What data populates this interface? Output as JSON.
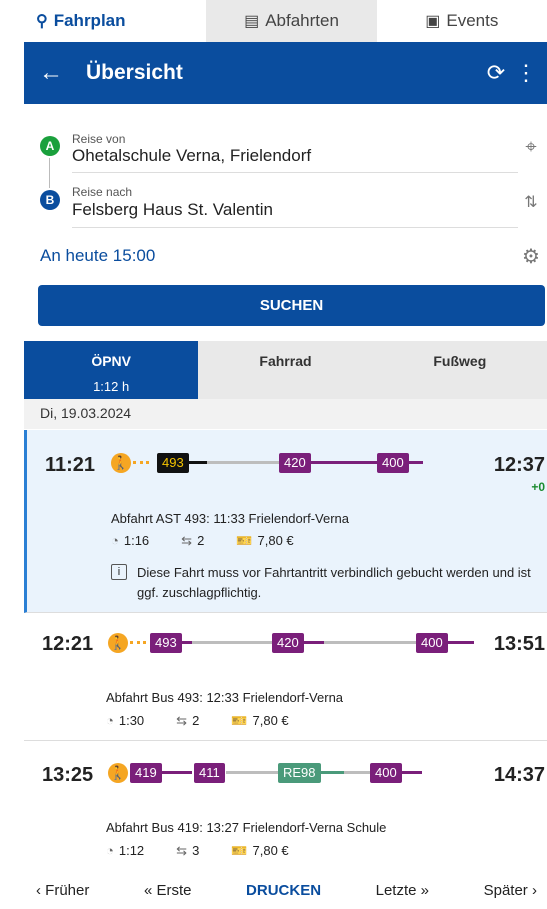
{
  "top_tabs": [
    {
      "label": "Fahrplan",
      "icon": "map-pin-icon"
    },
    {
      "label": "Abfahrten",
      "icon": "departures-icon"
    },
    {
      "label": "Events",
      "icon": "calendar-icon"
    }
  ],
  "header": {
    "title": "Übersicht",
    "back_icon": "arrow-left-icon",
    "refresh_icon": "refresh-icon",
    "menu_icon": "more-vertical-icon"
  },
  "form": {
    "from_label": "Reise von",
    "from_value": "Ohetalschule Verna, Frielendorf",
    "to_label": "Reise nach",
    "to_value": "Felsberg Haus St. Valentin",
    "marker_a": "A",
    "marker_b": "B",
    "time_text": "An heute 15:00",
    "search_label": "SUCHEN"
  },
  "mode_tabs": [
    {
      "label": "ÖPNV",
      "duration": "1:12 h"
    },
    {
      "label": "Fahrrad"
    },
    {
      "label": "Fußweg"
    }
  ],
  "date": "Di, 19.03.2024",
  "connections": [
    {
      "departure": "11:21",
      "arrival": "12:37",
      "delay": "+0",
      "lines": [
        "493",
        "420",
        "400"
      ],
      "info": "Abfahrt AST 493: 11:33 Frielendorf-Verna",
      "duration": "1:16",
      "changes": "2",
      "price": "7,80 €",
      "notice": "Diese Fahrt muss vor Fahrtantritt verbindlich gebucht werden und ist ggf. zuschlagpflichtig."
    },
    {
      "departure": "12:21",
      "arrival": "13:51",
      "lines": [
        "493",
        "420",
        "400"
      ],
      "info": "Abfahrt Bus 493: 12:33 Frielendorf-Verna",
      "duration": "1:30",
      "changes": "2",
      "price": "7,80 €"
    },
    {
      "departure": "13:25",
      "arrival": "14:37",
      "lines": [
        "419",
        "411",
        "RE98",
        "400"
      ],
      "info": "Abfahrt Bus 419: 13:27 Frielendorf-Verna Schule",
      "duration": "1:12",
      "changes": "3",
      "price": "7,80 €"
    }
  ],
  "footer": {
    "earlier": "Früher",
    "first": "Erste",
    "print": "DRUCKEN",
    "last": "Letzte",
    "later": "Später"
  },
  "colors": {
    "primary": "#0a4d9e",
    "walk": "#f5a623",
    "line_purple": "#7a1f7a",
    "line_green": "#4a9a7a",
    "delay_green": "#1a8a2e"
  }
}
